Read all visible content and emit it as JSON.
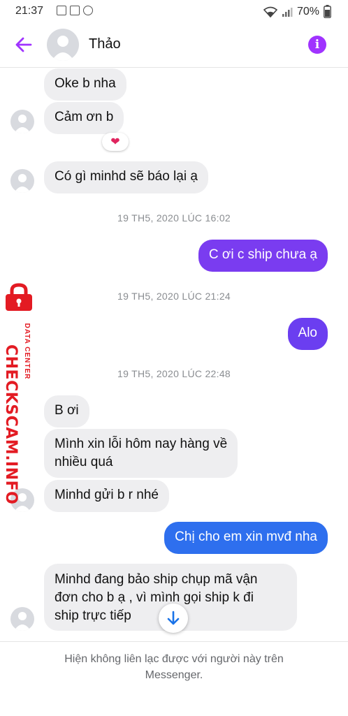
{
  "status_bar": {
    "time": "21:37",
    "battery": "70%"
  },
  "header": {
    "contact_name": "Thảo"
  },
  "messages": [
    {
      "dir": "in",
      "text": "Oke b nha"
    },
    {
      "dir": "in",
      "text": "Cảm ơn b",
      "reaction": "❤"
    },
    {
      "dir": "in",
      "text": "Có gì minhd sẽ báo lại ạ"
    },
    {
      "dir": "out",
      "text": "C ơi c ship chưa ạ",
      "color": "#7a3cf0"
    },
    {
      "dir": "out",
      "text": "Alo",
      "color": "#6b3ef0"
    },
    {
      "dir": "in",
      "text": "B ơi"
    },
    {
      "dir": "in",
      "text": "Mình xin lỗi hôm nay hàng về\nnhiều quá"
    },
    {
      "dir": "in",
      "text": "Minhd gửi b r nhé"
    },
    {
      "dir": "out",
      "text": "Chị cho em xin mvđ nha",
      "color": "#2e6fee"
    },
    {
      "dir": "in",
      "text": "Minhd đang bảo ship chụp mã vận\nđơn cho b ạ , vì mình gọi ship k đi\nship trực tiếp"
    }
  ],
  "timestamps": [
    "19 TH5, 2020 LÚC 16:02",
    "19 TH5, 2020 LÚC 21:24",
    "19 TH5, 2020 LÚC 22:48"
  ],
  "footer": {
    "notice": "Hiện không liên lạc được với người này trên Messenger."
  },
  "watermark": {
    "brand": "CHECKSCAM.INFO",
    "tagline": "DATA CENTER"
  },
  "colors": {
    "accent": "#a033ff",
    "incoming_bubble": "#eeeef0",
    "watermark": "#e31b23"
  }
}
